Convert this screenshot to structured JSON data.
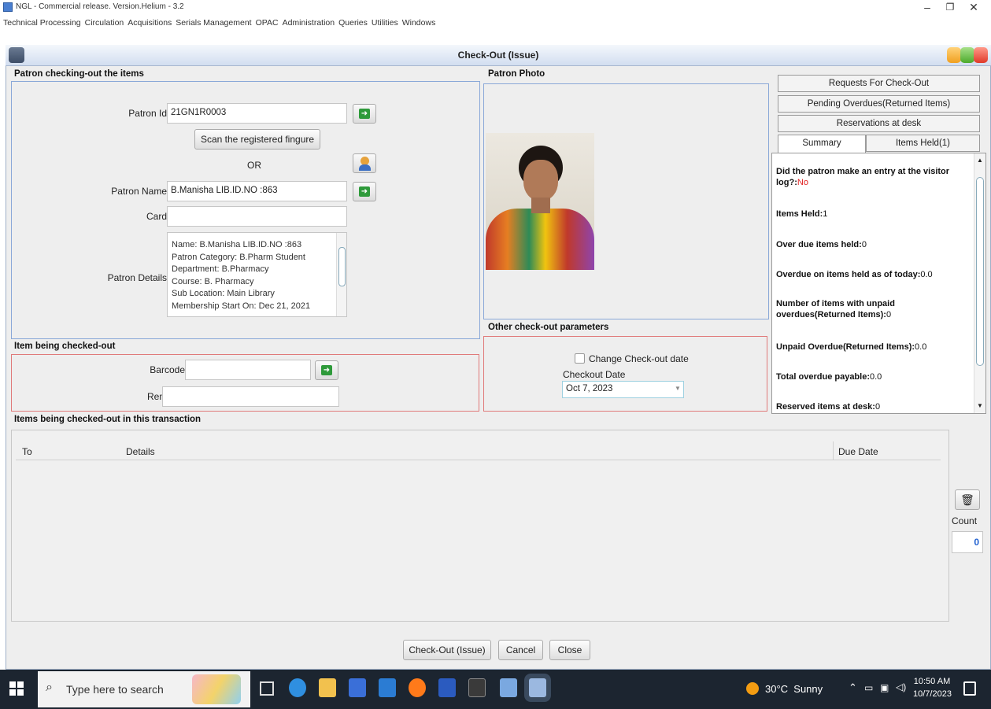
{
  "app": {
    "title": "NGL - Commercial release. Version.Helium - 3.2"
  },
  "menu": [
    "Technical Processing",
    "Circulation",
    "Acquisitions",
    "Serials Management",
    "OPAC",
    "Administration",
    "Queries",
    "Utilities",
    "Windows"
  ],
  "window": {
    "title": "Check-Out (Issue)"
  },
  "patron": {
    "section_title": "Patron checking-out the items",
    "patron_id_label": "Patron Id",
    "patron_id_value": "21GN1R0003",
    "scan_button": "Scan the registered fingure",
    "or_text": "OR",
    "patron_name_label": "Patron Name",
    "patron_name_value": "B.Manisha LIB.ID.NO :863",
    "card_label": "Card",
    "card_value": "",
    "details_label": "Patron Details",
    "details_lines": [
      "Name: B.Manisha LIB.ID.NO :863",
      "Patron Category: B.Pharm Student",
      "Department: B.Pharmacy",
      "Course: B. Pharmacy",
      "Sub Location: Main Library",
      "Membership Start On: Dec 21, 2021"
    ]
  },
  "photo": {
    "section_title": "Patron Photo"
  },
  "tabs": {
    "requests": "Requests For Check-Out",
    "pending": "Pending Overdues(Returned Items)",
    "reservations": "Reservations at desk",
    "summary": "Summary",
    "items_held": "Items Held(1)"
  },
  "summary": {
    "visitor_log_label": "Did the patron make an entry at the visitor log?:",
    "visitor_log_value": "No",
    "items_held_label": "Items Held:",
    "items_held_value": "1",
    "overdue_held_label": "Over due items held:",
    "overdue_held_value": "0",
    "overdue_today_label": "Overdue on items held as of today:",
    "overdue_today_value": "0.0",
    "unpaid_count_label": "Number of items with unpaid overdues(Returned Items):",
    "unpaid_count_value": "0",
    "unpaid_overdue_label": "Unpaid Overdue(Returned Items):",
    "unpaid_overdue_value": "0.0",
    "total_payable_label": "Total overdue payable:",
    "total_payable_value": "0.0",
    "reserved_label": "Reserved items at desk:",
    "reserved_value": "0"
  },
  "item": {
    "section_title": "Item being checked-out",
    "barcode_label": "Barcode",
    "barcode_value": "",
    "remarks_label": "Remarks",
    "remarks_value": ""
  },
  "params": {
    "section_title": "Other check-out parameters",
    "change_date_label": "Change Check-out date",
    "change_date_checked": false,
    "checkout_date_label": "Checkout Date",
    "checkout_date_value": "Oct 7, 2023"
  },
  "transaction": {
    "section_title": "Items being checked-out in this transaction",
    "columns": [
      "To",
      "Details",
      "Due Date"
    ],
    "rows": [],
    "count_label": "Count",
    "count_value": "0"
  },
  "buttons": {
    "checkout": "Check-Out (Issue)",
    "cancel": "Cancel",
    "close": "Close"
  },
  "taskbar": {
    "search_placeholder": "Type here to search",
    "weather": "30°C  Sunny",
    "time": "10:50 AM",
    "date": "10/7/2023"
  }
}
